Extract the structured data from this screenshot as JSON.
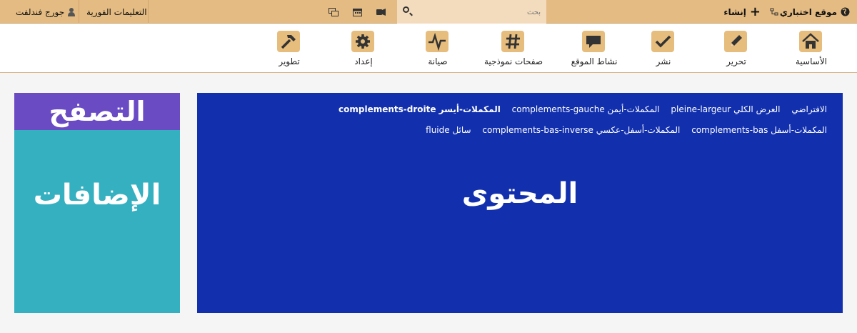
{
  "topbar": {
    "site_name": "موقع اختباري",
    "create_label": "إنشاء",
    "search_placeholder": "بحث",
    "instant_help_label": "التعليمات الفورية",
    "user_name": "جورج فندلفت"
  },
  "nav": [
    {
      "label": "الأساسية",
      "icon": "home-icon"
    },
    {
      "label": "تحرير",
      "icon": "pencil-icon"
    },
    {
      "label": "نشر",
      "icon": "check-icon"
    },
    {
      "label": "نشاط الموقع",
      "icon": "chat-icon"
    },
    {
      "label": "صفحات نموذجية",
      "icon": "hash-icon"
    },
    {
      "label": "صيانة",
      "icon": "pulse-icon"
    },
    {
      "label": "إعداد",
      "icon": "gear-icon"
    },
    {
      "label": "تطوير",
      "icon": "hammer-icon"
    }
  ],
  "content": {
    "options_row1": [
      {
        "text": "الافتراضي",
        "bold": false
      },
      {
        "text": "العرض الكلي pleine-largeur",
        "bold": false
      },
      {
        "text": "المكملات-أيمن complements-gauche",
        "bold": false
      },
      {
        "text": "المكملات-أيسر complements-droite",
        "bold": true
      }
    ],
    "options_row2": [
      {
        "text": "المكملات-أسفل complements-bas",
        "bold": false
      },
      {
        "text": "المكملات-أسفل-عكسي complements-bas-inverse",
        "bold": false
      },
      {
        "text": "سائل fluide",
        "bold": false
      }
    ],
    "title": "المحتوى"
  },
  "sidebar": {
    "browse_label": "التصفح",
    "addons_label": "الإضافات"
  }
}
